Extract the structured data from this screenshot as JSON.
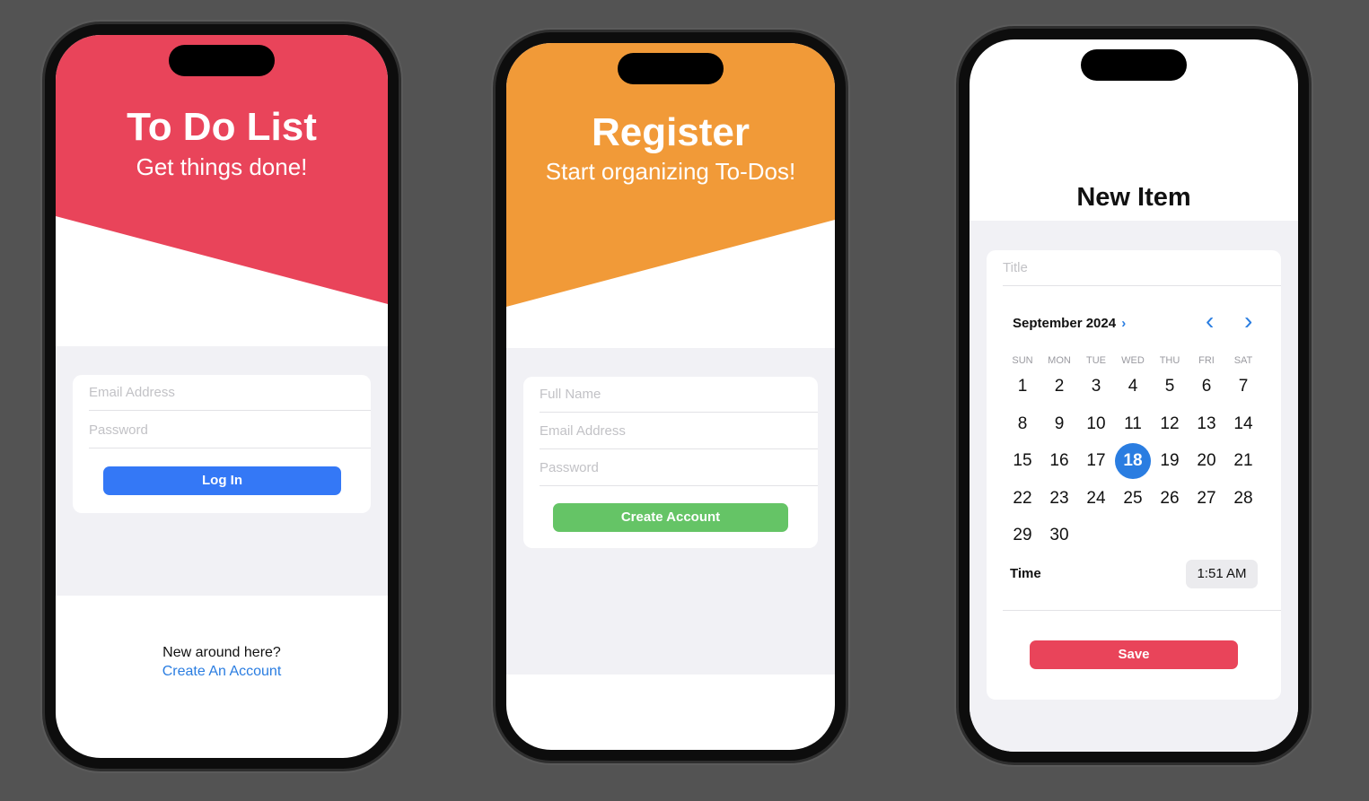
{
  "login": {
    "title": "To Do List",
    "subtitle": "Get things done!",
    "accent": "#e9445a",
    "email_placeholder": "Email Address",
    "password_placeholder": "Password",
    "login_button": "Log In",
    "login_button_color": "#3478f6",
    "footer_text": "New around here?",
    "footer_link": "Create An Account"
  },
  "register": {
    "title": "Register",
    "subtitle": "Start organizing To-Dos!",
    "accent": "#f19a38",
    "name_placeholder": "Full Name",
    "email_placeholder": "Email Address",
    "password_placeholder": "Password",
    "create_button": "Create Account",
    "create_button_color": "#65c466"
  },
  "new_item": {
    "title": "New Item",
    "title_placeholder": "Title",
    "month_label": "September 2024",
    "weekdays": [
      "SUN",
      "MON",
      "TUE",
      "WED",
      "THU",
      "FRI",
      "SAT"
    ],
    "weeks": [
      [
        "1",
        "2",
        "3",
        "4",
        "5",
        "6",
        "7"
      ],
      [
        "8",
        "9",
        "10",
        "11",
        "12",
        "13",
        "14"
      ],
      [
        "15",
        "16",
        "17",
        "18",
        "19",
        "20",
        "21"
      ],
      [
        "22",
        "23",
        "24",
        "25",
        "26",
        "27",
        "28"
      ],
      [
        "29",
        "30",
        "",
        "",
        "",
        "",
        ""
      ]
    ],
    "selected_day": "18",
    "time_label": "Time",
    "time_value": "1:51 AM",
    "save_button": "Save",
    "save_button_color": "#e9445a",
    "link_color": "#2a7de1"
  }
}
